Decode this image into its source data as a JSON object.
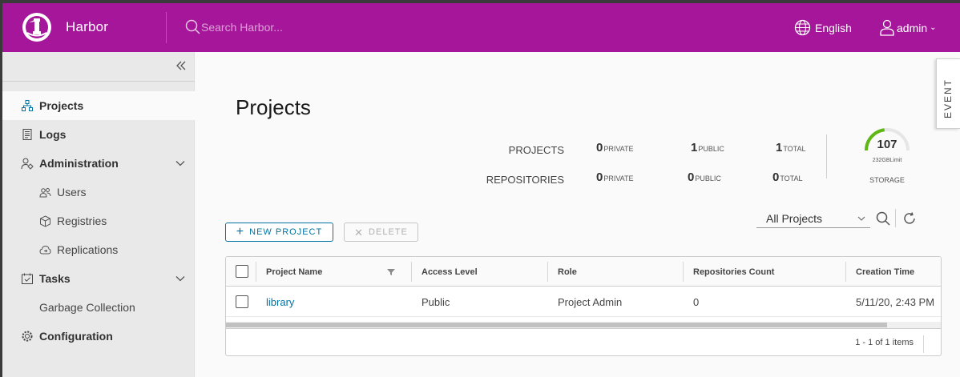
{
  "header": {
    "brand": "Harbor",
    "search_placeholder": "Search Harbor...",
    "language": "English",
    "user": "admin"
  },
  "colors": {
    "header": "#a6169a",
    "link": "#0072a3",
    "storage_arc": "#5eb715"
  },
  "sidebar": {
    "items": [
      {
        "label": "Projects",
        "icon": "projects-icon",
        "active": true
      },
      {
        "label": "Logs",
        "icon": "logs-icon"
      },
      {
        "label": "Administration",
        "icon": "administration-icon",
        "expanded": true,
        "children": [
          {
            "label": "Users",
            "icon": "users-icon"
          },
          {
            "label": "Registries",
            "icon": "registries-icon"
          },
          {
            "label": "Replications",
            "icon": "replications-icon"
          }
        ]
      },
      {
        "label": "Tasks",
        "icon": "tasks-icon",
        "expanded": true,
        "children": [
          {
            "label": "Garbage Collection"
          }
        ]
      },
      {
        "label": "Configuration",
        "icon": "configuration-icon"
      }
    ]
  },
  "main": {
    "title": "Projects",
    "stats": {
      "projects_label": "PROJECTS",
      "repositories_label": "REPOSITORIES",
      "projects": {
        "private": "0",
        "public": "1",
        "total": "1"
      },
      "repositories": {
        "private": "0",
        "public": "0",
        "total": "0"
      },
      "caption_private": "PRIVATE",
      "caption_public": "PUBLIC",
      "caption_total": "TOTAL"
    },
    "storage": {
      "value": "107",
      "limit": "232GBLimit",
      "caption": "STORAGE",
      "used_fraction": 0.46
    },
    "actions": {
      "new_project": "NEW PROJECT",
      "delete": "DELETE"
    },
    "filter": {
      "selected": "All Projects"
    },
    "grid": {
      "columns": [
        "Project Name",
        "Access Level",
        "Role",
        "Repositories Count",
        "Creation Time"
      ],
      "rows": [
        {
          "name": "library",
          "access": "Public",
          "role": "Project Admin",
          "repos": "0",
          "created": "5/11/20, 2:43 PM"
        }
      ],
      "footer": "1 - 1 of 1 items"
    },
    "event_tab": "EVENT"
  }
}
